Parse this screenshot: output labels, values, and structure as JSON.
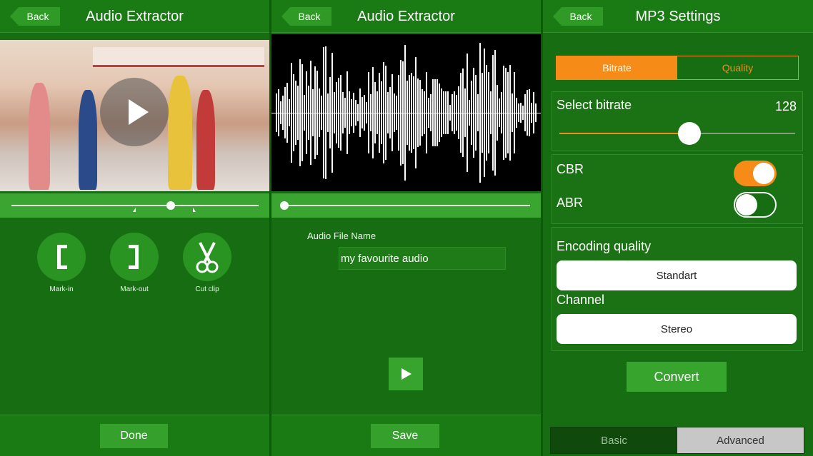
{
  "panel1": {
    "back_label": "Back",
    "title": "Audio Extractor",
    "tools": [
      {
        "label": "Mark-in",
        "icon": "mark-in-bracket-icon"
      },
      {
        "label": "Mark-out",
        "icon": "mark-out-bracket-icon"
      },
      {
        "label": "Cut clip",
        "icon": "scissors-icon"
      }
    ],
    "footer_button": "Done"
  },
  "panel2": {
    "back_label": "Back",
    "title": "Audio Extractor",
    "file_name_label": "Audio File Name",
    "file_name_value": "my favourite audio",
    "footer_button": "Save"
  },
  "panel3": {
    "back_label": "Back",
    "title": "MP3 Settings",
    "tabs": {
      "bitrate": "Bitrate",
      "quality": "Quality"
    },
    "bitrate_label": "Select bitrate",
    "bitrate_value": "128",
    "cbr_label": "CBR",
    "abr_label": "ABR",
    "cbr_on": true,
    "abr_on": false,
    "encoding_label": "Encoding quality",
    "encoding_value": "Standart",
    "channel_label": "Channel",
    "channel_value": "Stereo",
    "convert_label": "Convert",
    "bottom_tabs": {
      "basic": "Basic",
      "advanced": "Advanced"
    }
  },
  "colors": {
    "accent_orange": "#f78b18",
    "panel_green": "#176d12",
    "button_green": "#37a52d"
  }
}
